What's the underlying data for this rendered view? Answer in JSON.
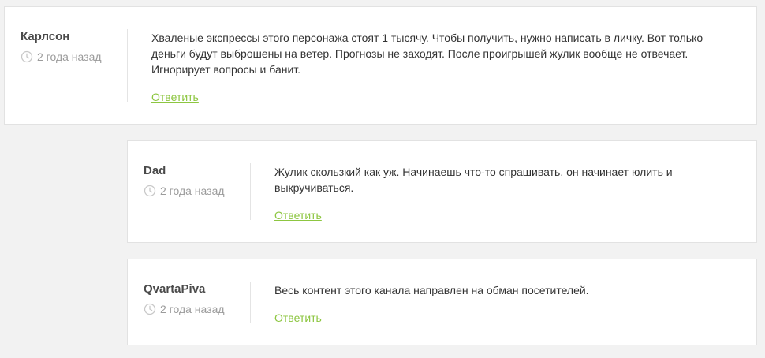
{
  "colors": {
    "background": "#f2f2f2",
    "card": "#ffffff",
    "accent": "#8dc641",
    "author": "#4a4a4a",
    "muted": "#9b9b9b"
  },
  "icons": {
    "date": "clock-icon"
  },
  "comments": [
    {
      "author": "Карлсон",
      "date": "2 года назад",
      "text": "Хваленые экспрессы этого персонажа стоят 1 тысячу. Чтобы получить, нужно написать в личку. Вот только деньги будут выброшены на ветер. Прогнозы не заходят. После проигрышей жулик вообще не отвечает. Игнорирует вопросы и банит.",
      "reply_label": "Ответить"
    },
    {
      "author": "Dad",
      "date": "2 года назад",
      "text": "Жулик скользкий как уж. Начинаешь что-то спрашивать, он начинает юлить и выкручиваться.",
      "reply_label": "Ответить"
    },
    {
      "author": "QvartaPiva",
      "date": "2 года назад",
      "text": "Весь контент этого канала направлен на обман посетителей.",
      "reply_label": "Ответить"
    }
  ]
}
